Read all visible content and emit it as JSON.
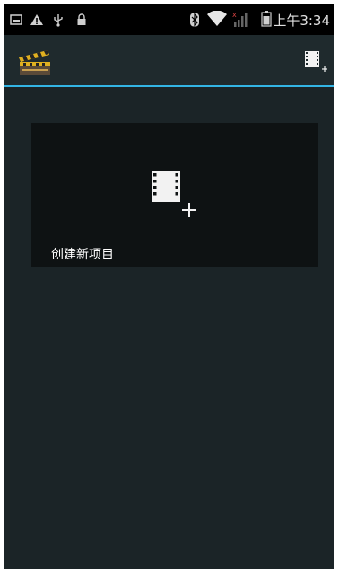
{
  "status_bar": {
    "icons": [
      "image-notification-icon",
      "warning-icon",
      "usb-icon",
      "lock-icon",
      "bluetooth-icon",
      "wifi-icon",
      "signal-icon",
      "battery-icon"
    ],
    "time": "上午3:34"
  },
  "action_bar": {
    "app_icon": "clapperboard-icon",
    "action_icon": "add-film-icon"
  },
  "main": {
    "create_project_label": "创建新项目"
  },
  "colors": {
    "status_bar_bg": "#000000",
    "action_bar_bg": "#1f2a2d",
    "accent": "#33b5e5",
    "background": "#1b2427",
    "card_bg": "#0e1213"
  }
}
